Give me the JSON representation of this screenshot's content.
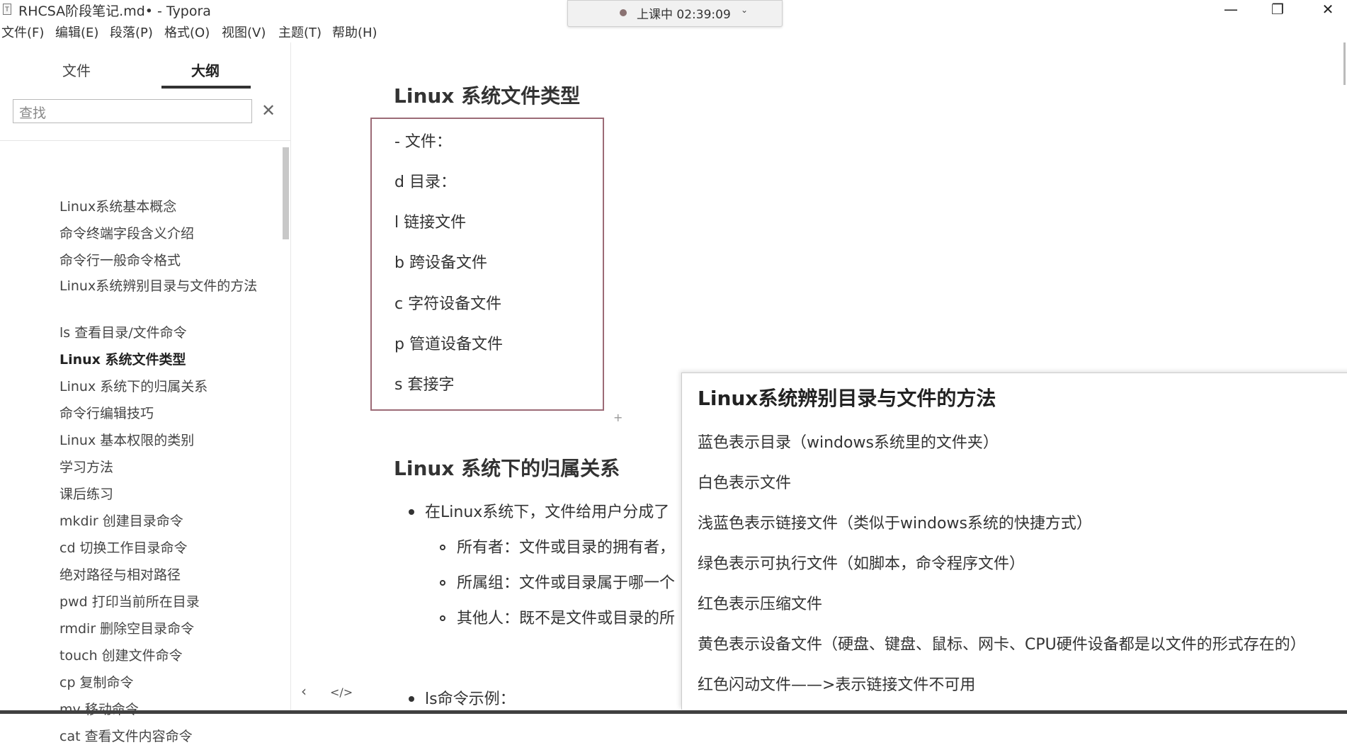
{
  "window": {
    "title": "RHCSA阶段笔记.md• - Typora",
    "app_icon": "T",
    "minimize": "—",
    "maximize": "❐",
    "close": "✕"
  },
  "recording": {
    "text": "上课中 02:39:09",
    "chevron": "⌄"
  },
  "menu": [
    "文件(F)",
    "编辑(E)",
    "段落(P)",
    "格式(O)",
    "视图(V)",
    "主题(T)",
    "帮助(H)"
  ],
  "sidebar": {
    "tabs": {
      "files": "文件",
      "outline": "大纲"
    },
    "search_placeholder": "查找",
    "clear": "✕",
    "outline": [
      "Linux系统基本概念",
      "命令终端字段含义介绍",
      "命令行一般命令格式",
      "Linux系统辨别目录与文件的方法",
      "ls 查看目录/文件命令",
      "Linux 系统文件类型",
      "Linux 系统下的归属关系",
      "命令行编辑技巧",
      "Linux 基本权限的类别",
      "学习方法",
      "课后练习",
      "mkdir 创建目录命令",
      "cd 切换工作目录命令",
      "绝对路径与相对路径",
      "pwd 打印当前所在目录",
      "rmdir 删除空目录命令",
      "touch 创建文件命令",
      "cp 复制命令",
      "mv 移动命令",
      "cat 查看文件内容命令"
    ],
    "active_index": 5
  },
  "editor": {
    "heading1": "Linux 系统文件类型",
    "file_types": [
      "- 文件：",
      "d 目录：",
      "l 链接文件",
      "b 跨设备文件",
      "c 字符设备文件",
      "p 管道设备文件",
      "s 套接字"
    ],
    "plus": "+",
    "heading2": "Linux 系统下的归属关系",
    "bullet_main": "在Linux系统下，文件给用户分成了",
    "sub_bullets": [
      "所有者：文件或目录的拥有者，",
      "所属组：文件或目录属于哪一个",
      "其他人：既不是文件或目录的所"
    ],
    "bullet_ls": "ls命令示例："
  },
  "popup": {
    "title": "Linux系统辨别目录与文件的方法",
    "lines": [
      "蓝色表示目录（windows系统里的文件夹）",
      "白色表示文件",
      "浅蓝色表示链接文件（类似于windows系统的快捷方式）",
      "绿色表示可执行文件（如脚本，命令程序文件）",
      "红色表示压缩文件",
      "黄色表示设备文件（硬盘、键盘、鼠标、网卡、CPU硬件设备都是以文件的形式存在的）",
      "红色闪动文件——>表示链接文件不可用"
    ]
  },
  "footer": {
    "prev": "‹",
    "source": "</>"
  }
}
